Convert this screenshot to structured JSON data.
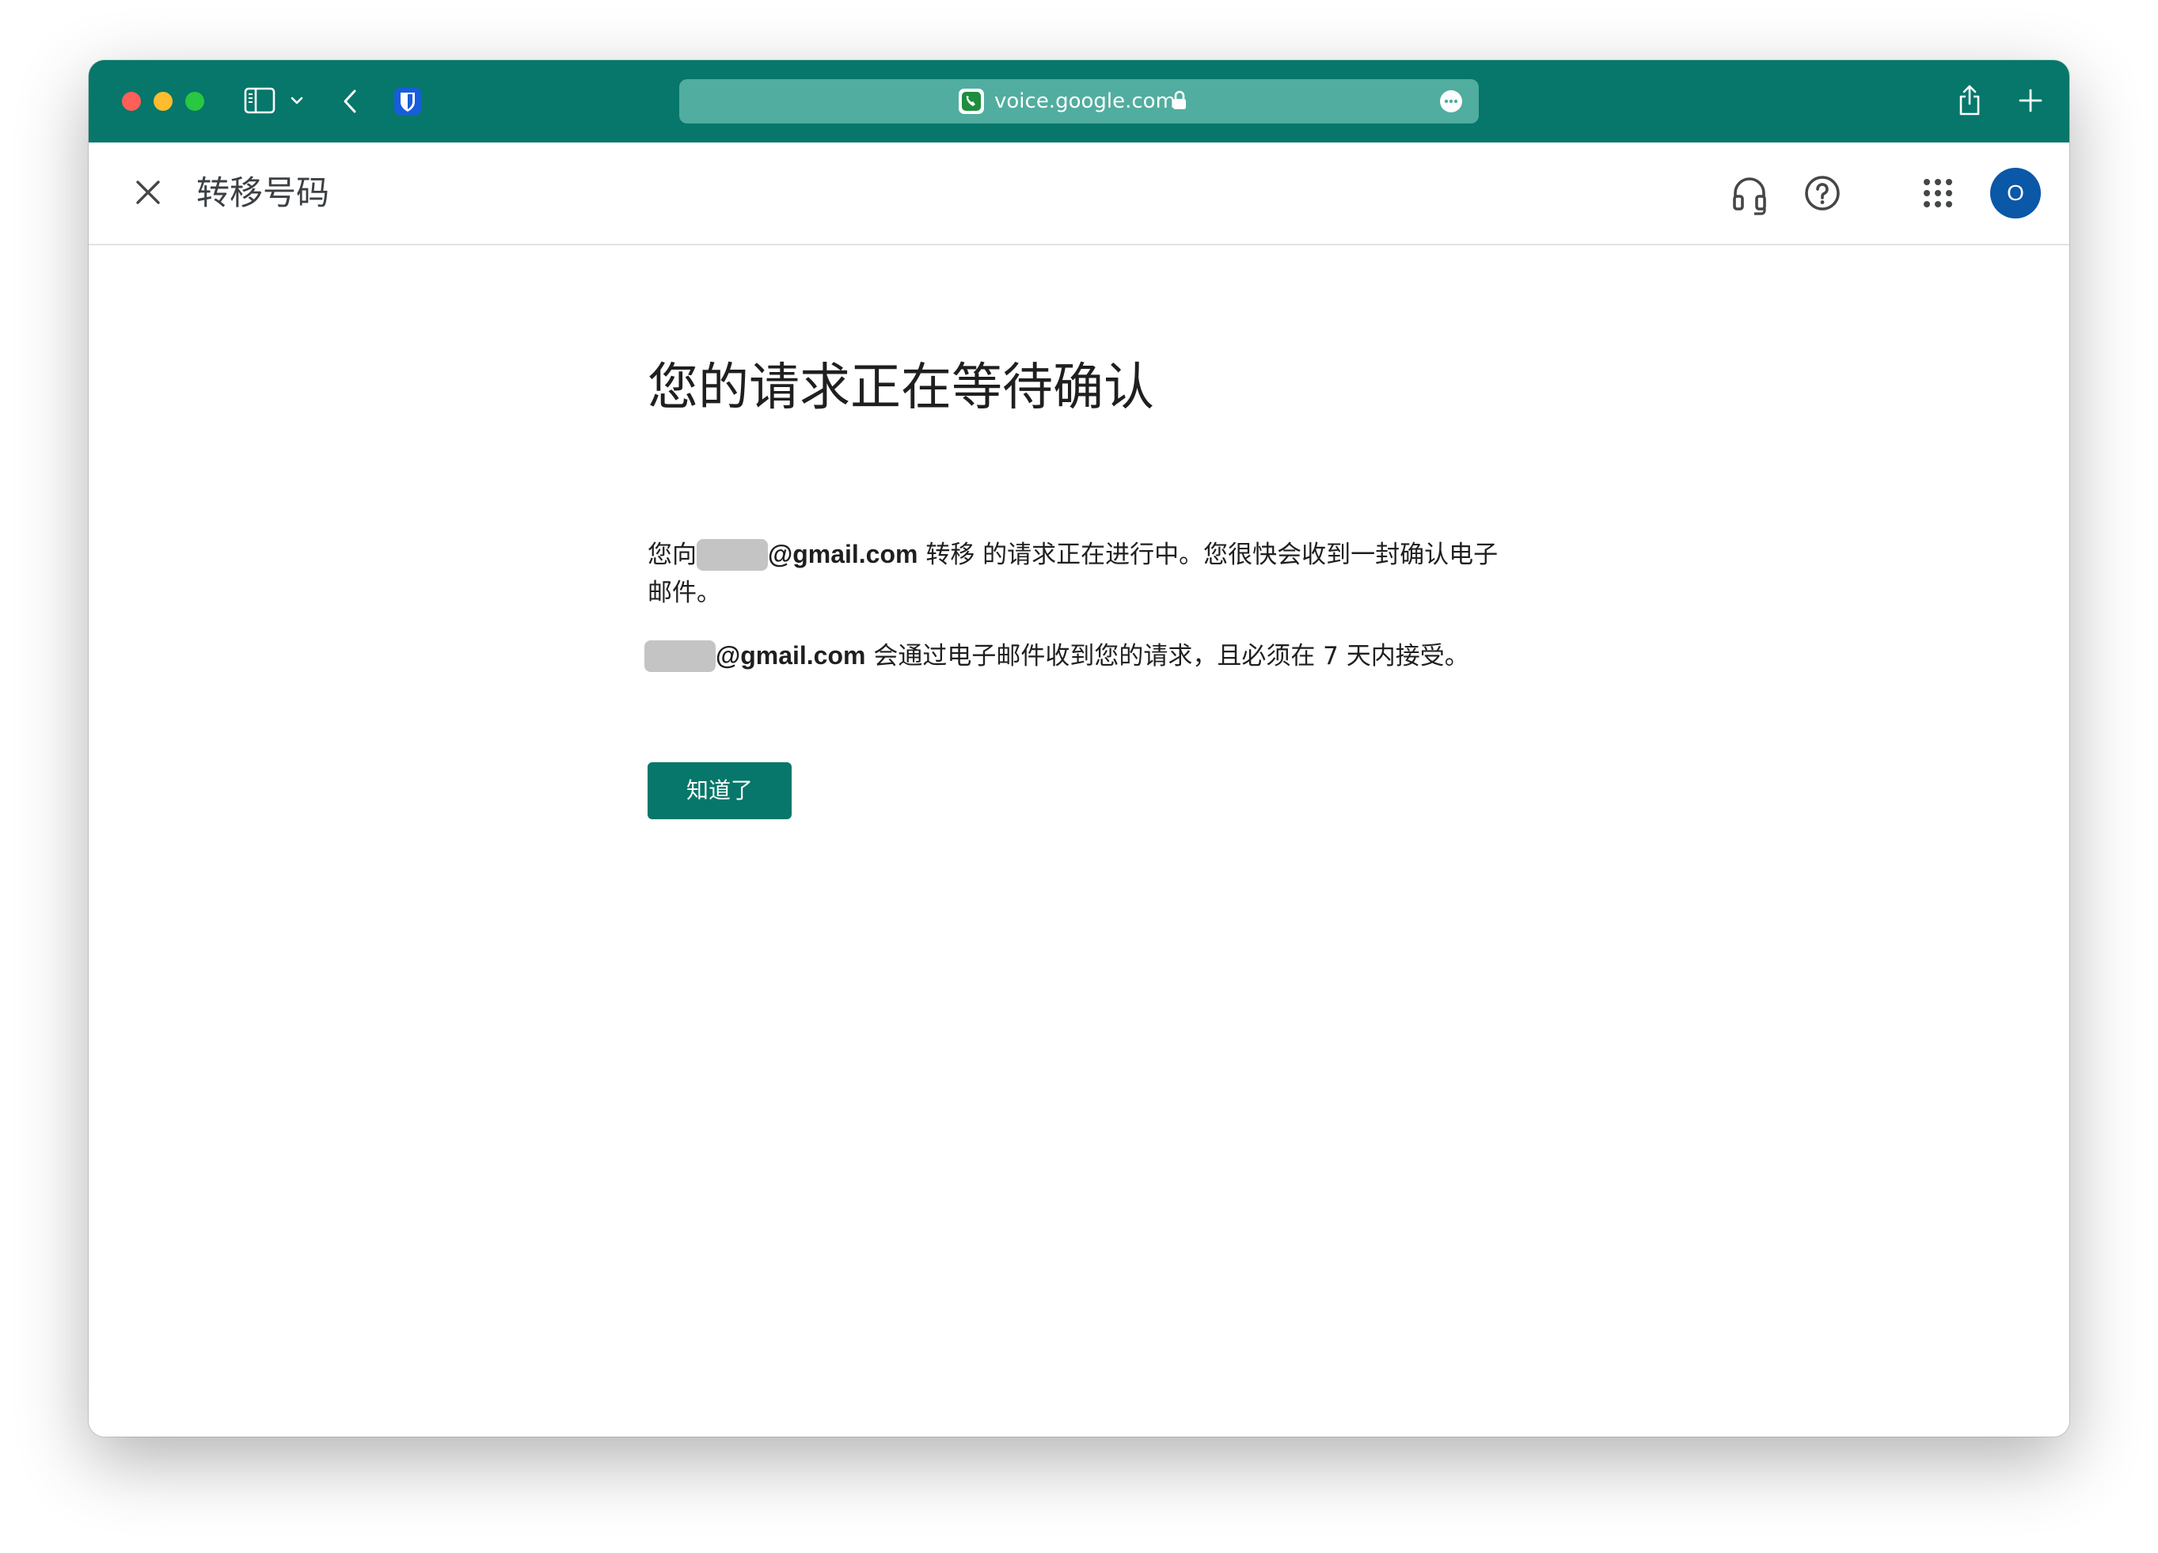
{
  "browser": {
    "url": "voice.google.com",
    "icons": [
      "sidebar-toggle-icon",
      "chevron-down-icon",
      "back-arrow-icon",
      "bitwarden-extension-icon",
      "google-voice-favicon",
      "lock-icon",
      "more-options-icon",
      "share-icon",
      "new-tab-icon"
    ]
  },
  "appbar": {
    "title": "转移号码",
    "avatar_initial": "O",
    "icons": [
      "close-icon",
      "headset-support-icon",
      "help-icon",
      "apps-grid-icon"
    ]
  },
  "main": {
    "heading": "您的请求正在等待确认",
    "para1": {
      "prefix": "您向",
      "email_suffix": "@gmail.com",
      "text": " 转移 的请求正在进行中。您很快会收到一封确认电子邮件。"
    },
    "para2": {
      "email_suffix": "@gmail.com",
      "text": " 会通过电子邮件收到您的请求，且必须在 7 天内接受。"
    },
    "button_label": "知道了"
  },
  "colors": {
    "titlebar": "#06776a",
    "urlbar": "#51ad9f",
    "button": "#06776a",
    "avatar": "#0b57a8",
    "redaction": "#c4c4c4"
  }
}
